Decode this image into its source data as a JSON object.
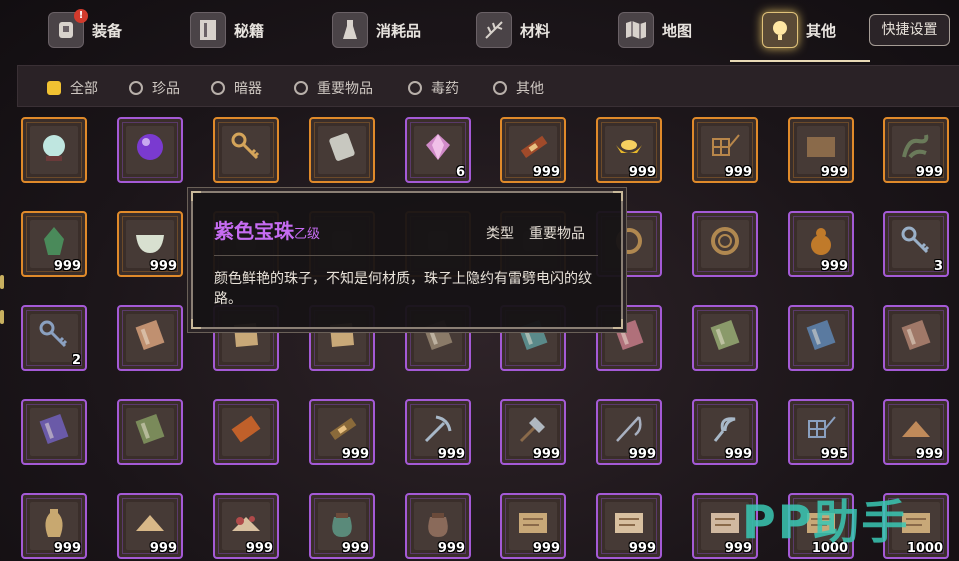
{
  "nav": {
    "tabs": [
      {
        "id": "equip",
        "label": "装备",
        "icon": "armor-icon",
        "badge": "!"
      },
      {
        "id": "manual",
        "label": "秘籍",
        "icon": "book-icon"
      },
      {
        "id": "consume",
        "label": "消耗品",
        "icon": "potion-icon"
      },
      {
        "id": "material",
        "label": "材料",
        "icon": "herb-icon"
      },
      {
        "id": "map",
        "label": "地图",
        "icon": "map-icon"
      },
      {
        "id": "other",
        "label": "其他",
        "icon": "lamp-icon",
        "active": true
      }
    ],
    "quick_settings": "快捷设置"
  },
  "filters": [
    {
      "label": "全部",
      "selected": true
    },
    {
      "label": "珍品"
    },
    {
      "label": "暗器"
    },
    {
      "label": "重要物品"
    },
    {
      "label": "毒药"
    },
    {
      "label": "其他"
    }
  ],
  "items": [
    [
      {
        "r": "gold",
        "icon": "crystal-ball-icon",
        "color": "#bfe6e0"
      },
      {
        "r": "purple",
        "icon": "purple-pearl-icon",
        "color": "#7a3ad0"
      },
      {
        "r": "gold",
        "icon": "key-icon",
        "color": "#d4a45a"
      },
      {
        "r": "gold",
        "icon": "token-icon",
        "color": "#c8c8c0"
      },
      {
        "r": "purple",
        "icon": "gem-icon",
        "color": "#d08ac8",
        "count": "6"
      },
      {
        "r": "gold",
        "icon": "scroll-icon",
        "color": "#a04a2a",
        "count": "999"
      },
      {
        "r": "gold",
        "icon": "gold-ingot-icon",
        "color": "#e8b82a",
        "count": "999"
      },
      {
        "r": "gold",
        "icon": "net-icon",
        "color": "#b8864a",
        "count": "999"
      },
      {
        "r": "gold",
        "icon": "map-scroll-icon",
        "color": "#8a6a4a",
        "count": "999"
      },
      {
        "r": "gold",
        "icon": "dragon-icon",
        "color": "#6a7a5a",
        "count": "999"
      }
    ],
    [
      {
        "r": "gold",
        "icon": "jade-statue-icon",
        "color": "#4a8a5a",
        "count": "999"
      },
      {
        "r": "gold",
        "icon": "bowl-icon",
        "color": "#d8e0d0",
        "count": "999"
      },
      {
        "r": "gold",
        "icon": "hidden-icon",
        "color": "#6a5a4a"
      },
      {
        "r": "gold",
        "icon": "hidden-icon",
        "color": "#6a5a4a"
      },
      {
        "r": "gold",
        "icon": "hidden-icon",
        "color": "#6a5a4a"
      },
      {
        "r": "gold",
        "icon": "hidden-icon",
        "color": "#6a5a4a"
      },
      {
        "r": "purple",
        "icon": "rope-icon",
        "color": "#b08850"
      },
      {
        "r": "purple",
        "icon": "rope-coil-icon",
        "color": "#b08850"
      },
      {
        "r": "purple",
        "icon": "gourd-icon",
        "color": "#c07a2a",
        "count": "999"
      },
      {
        "r": "purple",
        "icon": "key-icon",
        "color": "#9ab0c8",
        "count": "3"
      }
    ],
    [
      {
        "r": "purple",
        "icon": "key-icon",
        "color": "#8aa0c0",
        "count": "2"
      },
      {
        "r": "purple",
        "icon": "book-icon",
        "color": "#c09070"
      },
      {
        "r": "purple",
        "icon": "paper-icon",
        "color": "#c8a878"
      },
      {
        "r": "purple",
        "icon": "paper-icon",
        "color": "#c8a878"
      },
      {
        "r": "purple",
        "icon": "book-icon",
        "color": "#8a7a68"
      },
      {
        "r": "purple",
        "icon": "book-icon",
        "color": "#5a8a8a"
      },
      {
        "r": "purple",
        "icon": "book-icon",
        "color": "#b0707a"
      },
      {
        "r": "purple",
        "icon": "book-icon",
        "color": "#8a9a6a"
      },
      {
        "r": "purple",
        "icon": "book-icon",
        "color": "#5a7aa0"
      },
      {
        "r": "purple",
        "icon": "book-icon",
        "color": "#a07868"
      }
    ],
    [
      {
        "r": "purple",
        "icon": "book-icon",
        "color": "#6a5aa8"
      },
      {
        "r": "purple",
        "icon": "book-icon",
        "color": "#7a8a5a"
      },
      {
        "r": "purple",
        "icon": "brick-icon",
        "color": "#c0602a"
      },
      {
        "r": "purple",
        "icon": "scroll-icon",
        "color": "#8a6a3a",
        "count": "999"
      },
      {
        "r": "purple",
        "icon": "pickaxe-icon",
        "color": "#a8b8c8",
        "count": "999"
      },
      {
        "r": "purple",
        "icon": "axe-icon",
        "color": "#b0b8c0",
        "count": "999"
      },
      {
        "r": "purple",
        "icon": "fishing-rod-icon",
        "color": "#a8b0c0",
        "count": "999"
      },
      {
        "r": "purple",
        "icon": "sickle-icon",
        "color": "#a8b8c8",
        "count": "999"
      },
      {
        "r": "purple",
        "icon": "net-icon",
        "color": "#8aa0c0",
        "count": "995"
      },
      {
        "r": "purple",
        "icon": "powder-icon",
        "color": "#c08a5a",
        "count": "999"
      }
    ],
    [
      {
        "r": "purple",
        "icon": "vase-icon",
        "color": "#c8a870",
        "count": "999"
      },
      {
        "r": "purple",
        "icon": "powder-icon",
        "color": "#d8b888",
        "count": "999"
      },
      {
        "r": "purple",
        "icon": "flower-powder-icon",
        "color": "#b04a4a",
        "count": "999"
      },
      {
        "r": "purple",
        "icon": "pouch-icon",
        "color": "#5a8a7a",
        "count": "999"
      },
      {
        "r": "purple",
        "icon": "pouch-icon",
        "color": "#8a6a5a",
        "count": "999"
      },
      {
        "r": "purple",
        "icon": "map-scroll-icon",
        "color": "#c8a878",
        "count": "999"
      },
      {
        "r": "purple",
        "icon": "map-scroll-icon",
        "color": "#d8c0a0",
        "count": "999"
      },
      {
        "r": "purple",
        "icon": "map-scroll-icon",
        "color": "#d0b8a0",
        "count": "999"
      },
      {
        "r": "purple",
        "icon": "map-scroll-icon",
        "color": "#c8a878",
        "count": "1000"
      },
      {
        "r": "purple",
        "icon": "map-scroll-icon",
        "color": "#c8a878",
        "count": "1000"
      }
    ]
  ],
  "tooltip": {
    "name": "紫色宝珠",
    "grade": "乙级",
    "type_label": "类型",
    "type_value": "重要物品",
    "description": "颜色鲜艳的珠子，不知是何材质，珠子上隐约有雷劈电闪的纹路。"
  },
  "watermark": "PP助手",
  "colors": {
    "gold_border": "#e08a2a",
    "purple_border": "#a45ad6",
    "tooltip_name": "#c66cf2",
    "selected_filter": "#f1c232"
  }
}
